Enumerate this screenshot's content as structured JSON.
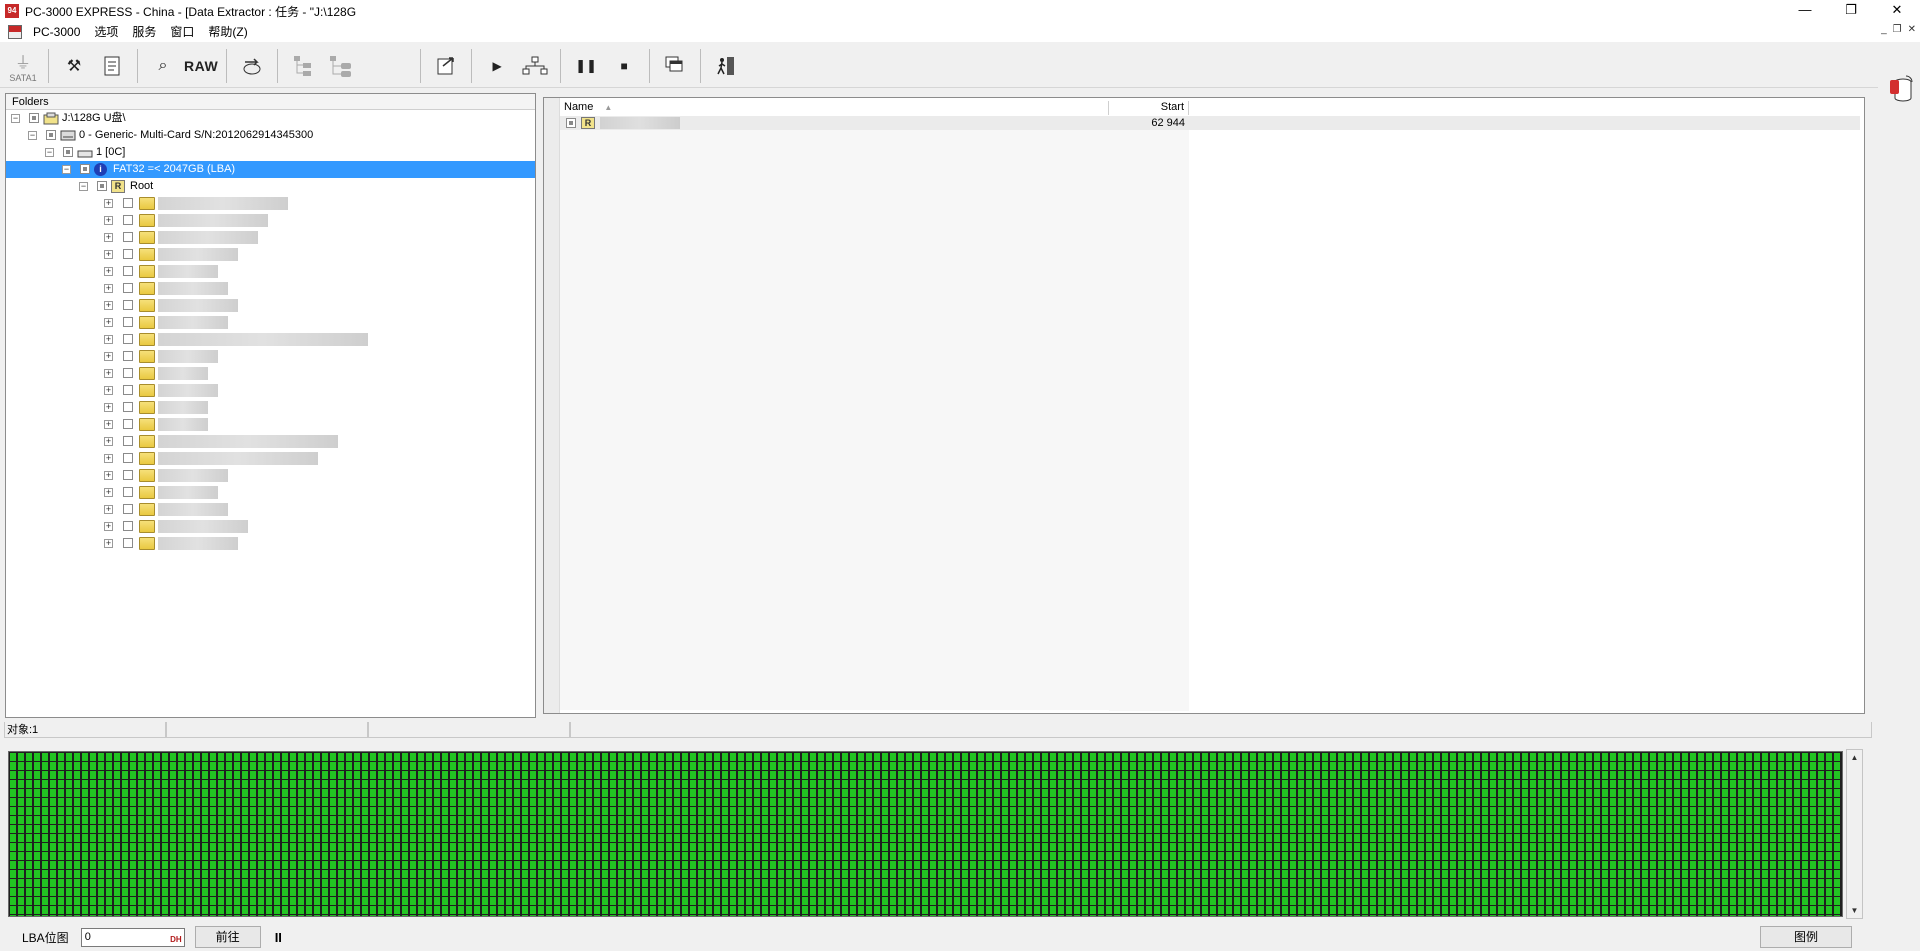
{
  "window": {
    "title": "PC-3000 EXPRESS - China - [Data Extractor : 任务 - \"J:\\128G",
    "app_icon_text": "94",
    "controls": [
      "—",
      "❐",
      "✕"
    ]
  },
  "menu": {
    "items": [
      "PC-3000",
      "选项",
      "服务",
      "窗口",
      "帮助(Z)"
    ],
    "mdi_controls": [
      "_",
      "❐",
      "✕"
    ]
  },
  "toolbar": {
    "sata_label": "SATA1",
    "raw_label": "RAW"
  },
  "tree": {
    "header": "Folders",
    "root": "J:\\128G U盘\\",
    "device": "0 - Generic- Multi-Card  S/N:2012062914345300",
    "partition": "1 [0C]",
    "filesystem": "FAT32 =< 2047GB (LBA)",
    "root_folder": "Root",
    "root_badge": "R",
    "info_badge": "i"
  },
  "list": {
    "col_name": "Name",
    "col_start": "Start",
    "row_badge": "R",
    "row_start": "62 944"
  },
  "status": {
    "objects": "对象:1"
  },
  "bottom": {
    "lba_label": "LBA位图",
    "lba_value": "0",
    "dh_label": "DH",
    "goto_label": "前往",
    "pause_label": "II",
    "legend_label": "图例"
  },
  "colors": {
    "selection": "#3399ff",
    "lba_ok": "#22c422",
    "folder": "#f0d35c"
  }
}
